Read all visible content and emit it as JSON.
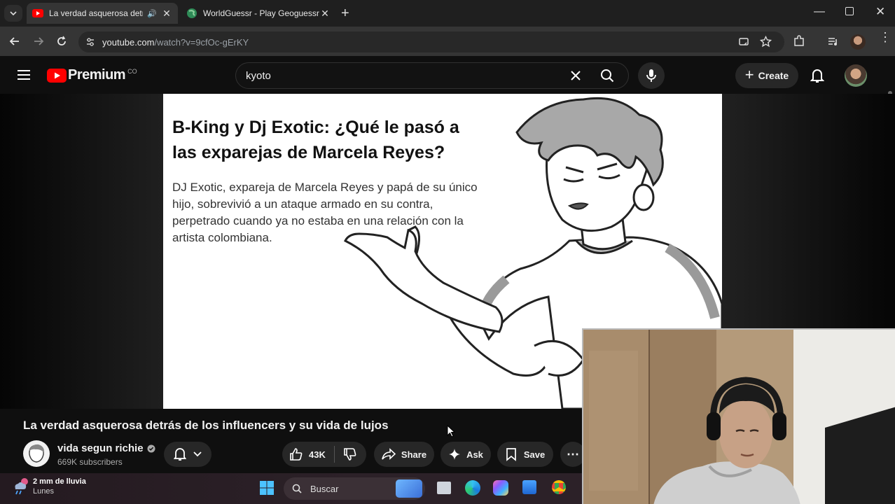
{
  "browser": {
    "tabs": [
      {
        "title": "La verdad asquerosa detrás de los influencers",
        "active": true
      },
      {
        "title": "WorldGuessr - Play Geoguessr Free",
        "active": false
      }
    ],
    "url_host": "youtube.com",
    "url_path": "/watch?v=9cfOc-gErKY"
  },
  "youtube": {
    "logo_text": "Premium",
    "region": "CO",
    "search_query": "kyoto",
    "create_label": "Create"
  },
  "video_frame": {
    "headline": "B-King y Dj Exotic: ¿Qué le pasó a las exparejas de Marcela Reyes?",
    "body": "DJ Exotic, expareja de Marcela Reyes y papá de su único hijo, sobrevivió a un ataque armado en su contra, perpetrado cuando ya no estaba en una relación con la artista colombiana."
  },
  "video": {
    "title": "La verdad asquerosa detrás de los influencers y su vida de lujos",
    "channel": "vida segun richie",
    "subscribers": "669K subscribers",
    "likes": "43K",
    "share_label": "Share",
    "ask_label": "Ask",
    "save_label": "Save"
  },
  "taskbar": {
    "weather": "2 mm de lluvia",
    "weather_day": "Lunes",
    "search_placeholder": "Buscar"
  }
}
